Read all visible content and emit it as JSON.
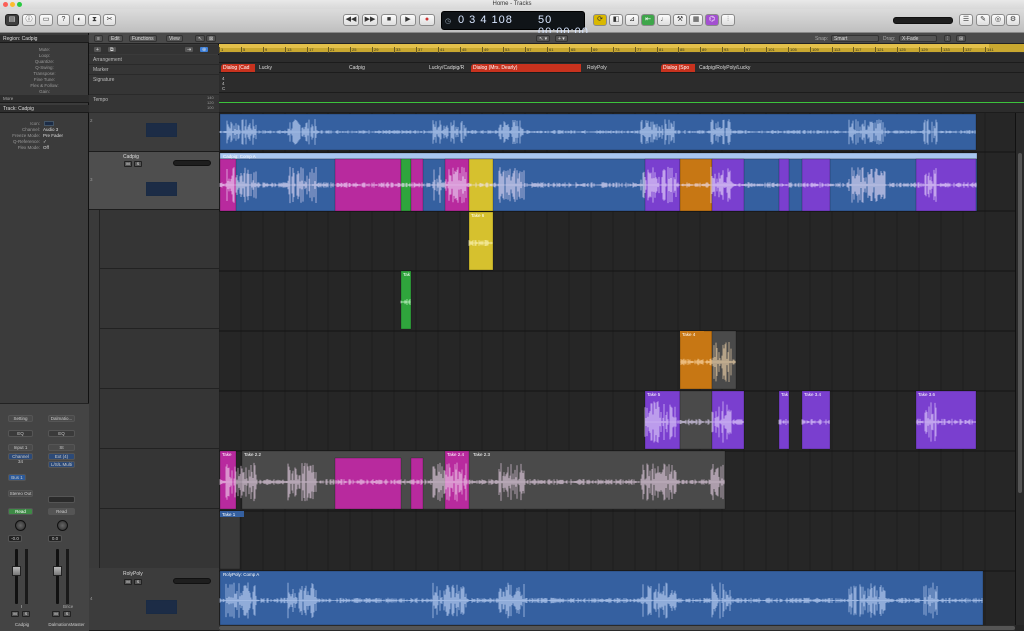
{
  "window": {
    "title": "Home - Tracks"
  },
  "transport": {
    "bar": "3",
    "beat": "4",
    "division": "1",
    "tick": "108",
    "bar_display": "0  3  4  108",
    "time_display": "50 00:00:00",
    "tempo": "120",
    "sig": "4/4"
  },
  "local_menu": {
    "edit": "Edit",
    "functions": "Functions",
    "view": "View"
  },
  "snap": {
    "label": "Snap:",
    "value": "Smart"
  },
  "drag": {
    "label": "Drag:",
    "value": "X-Fade"
  },
  "global_tracks": [
    {
      "name": "Arrangement"
    },
    {
      "name": "Marker"
    },
    {
      "name": "Signature"
    },
    {
      "name": "Tempo"
    }
  ],
  "tempo_values": {
    "top": "140",
    "mid": "120",
    "bottom": "100"
  },
  "markers": [
    {
      "label": "Dialog (Cad",
      "style": "red"
    },
    {
      "label": "Lucky",
      "style": "plain"
    },
    {
      "label": "Cadpig",
      "style": "plain"
    },
    {
      "label": "Lucky/Cadpig/R",
      "style": "plain"
    },
    {
      "label": "Dialog (Mrs. Dearly)",
      "style": "red"
    },
    {
      "label": "RolyPoly",
      "style": "plain"
    },
    {
      "label": "Dialog (Spo",
      "style": "red"
    },
    {
      "label": "Cadpig/RolyPoly/Lucky",
      "style": "plain"
    }
  ],
  "signature": {
    "value": "4",
    "sub": "4",
    "key": "C"
  },
  "ruler_ticks": [
    "1",
    "5",
    "9",
    "13",
    "17",
    "21",
    "25",
    "29",
    "33",
    "37",
    "41",
    "45",
    "49",
    "53",
    "57",
    "61",
    "65",
    "69",
    "73",
    "77",
    "81",
    "85",
    "89",
    "93",
    "97",
    "101",
    "105",
    "109",
    "113",
    "117",
    "121",
    "125",
    "129",
    "133",
    "137",
    "141"
  ],
  "inspector": {
    "region_header": "Region:  Cadpig",
    "region_rows": [
      "Mute:",
      "Loop:",
      "Quantize:",
      "Q-Swing:",
      "Transpose:",
      "Fine Tune:",
      "Flex & Follow:",
      "Gain:"
    ],
    "more_label": "More",
    "track_header": "Track:  Cadpig",
    "track_rows": [
      {
        "k": "Icon:",
        "v": ""
      },
      {
        "k": "Channel:",
        "v": "Audio 3"
      },
      {
        "k": "Freeze Mode:",
        "v": "Pre Fader"
      },
      {
        "k": "Q-Reference:",
        "v": "✓"
      },
      {
        "k": "Flex Mode:",
        "v": "Off"
      }
    ],
    "strip1": {
      "setting": "Setting",
      "eq": "EQ",
      "input": "Input 1",
      "input2": "Channel 34",
      "send": "Bus 1",
      "output": "Stereo Out",
      "automation": "Read",
      "pan": "-0.0",
      "name": "Cadpig",
      "m": "M",
      "s": "S"
    },
    "strip2": {
      "setting": "Dalmatio...",
      "eq": "EQ",
      "input": "St",
      "input2": "Ext (4)",
      "send": "L/S/L Multi",
      "output": "",
      "automation": "Read",
      "pan": "0.0",
      "name": "DalmationsMaster",
      "m": "M",
      "s": "S",
      "tag": "Bnce"
    }
  },
  "tracks": [
    {
      "num": "2",
      "name": "",
      "row": "top"
    },
    {
      "num": "3",
      "name": "Cadpig",
      "m": "M",
      "s": "S"
    },
    {
      "num": "4",
      "name": "RolyPoly",
      "m": "M",
      "s": "S"
    }
  ],
  "regions": [
    {
      "label": "Cadpig: Comp A",
      "name": "comp-a-header"
    },
    {
      "label": "Take 6"
    },
    {
      "label": "Tak"
    },
    {
      "label": "Take 4"
    },
    {
      "label": "Take 5"
    },
    {
      "label": "Tak"
    },
    {
      "label": "Take 3.4"
    },
    {
      "label": "Take 3.6"
    },
    {
      "label": "Take"
    },
    {
      "label": "Take 2.2"
    },
    {
      "label": "Take 2.4"
    },
    {
      "label": "Take 2.3"
    },
    {
      "label": "Take 1"
    },
    {
      "label": "RolyPoly: Comp A"
    }
  ],
  "colors": {
    "blue": "#3560a0",
    "magenta": "#b82a9e",
    "yellow": "#d6c12e",
    "green": "#2fa53c",
    "orange": "#c77714",
    "purple": "#7a3fcf",
    "gray": "#4a4a4a",
    "ruler": "#c9a830",
    "red": "#c8321e"
  }
}
